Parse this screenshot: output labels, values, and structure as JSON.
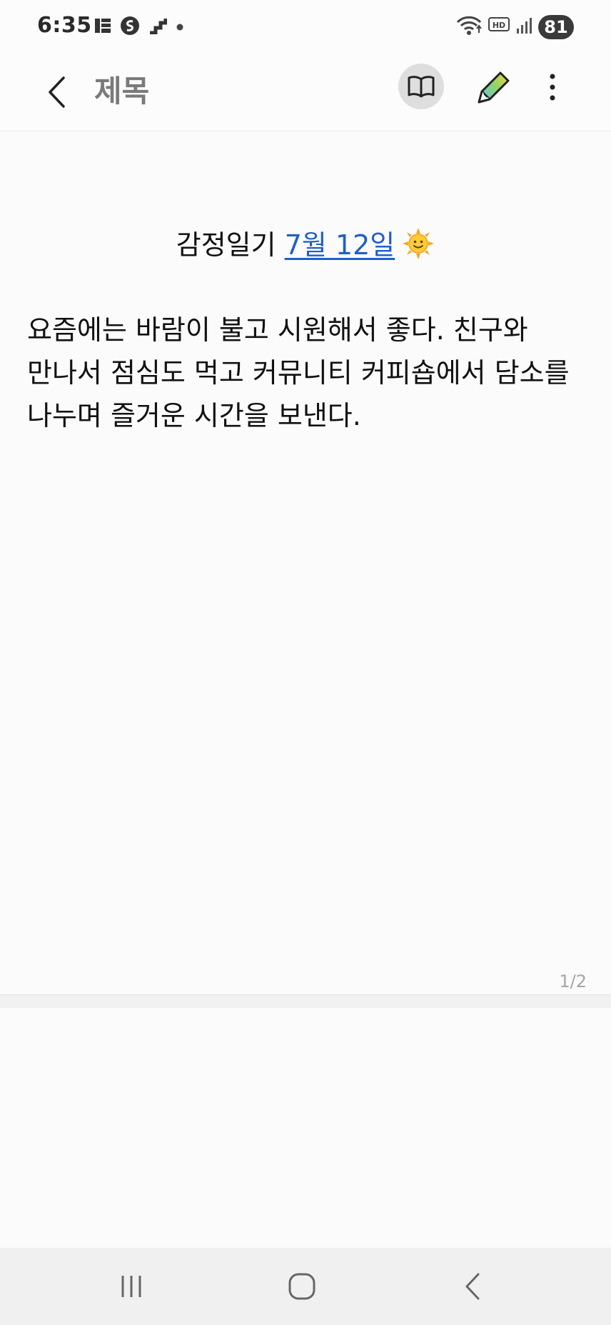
{
  "status_bar": {
    "time": "6:35",
    "battery": "81",
    "icons": [
      "grid-notification-icon",
      "samsung-s-icon",
      "staircase-icon",
      "dot-icon",
      "wifi-icon",
      "hd-voice-icon",
      "signal-icon"
    ]
  },
  "app_bar": {
    "title": "제목",
    "icons": [
      "back-chevron-icon",
      "book-reader-icon",
      "pen-icon",
      "more-vertical-icon"
    ]
  },
  "note": {
    "title_prefix": "감정일기 ",
    "title_date": "7월 12일",
    "title_emoji": "sun-face-icon",
    "body": "요즘에는 바람이 불고 시원해서 좋다.  친구와 만나서 점심도 먹고 커뮤니티 커피숍에서 담소를 나누며 즐거운 시간을 보낸다."
  },
  "page_indicator": "1/2",
  "colors": {
    "link": "#1f5fc9",
    "title_gray": "#7a7a7a",
    "background": "#fbfbfb",
    "nav_background": "#f0f0f0"
  },
  "nav_bar": {
    "icons": [
      "recent-apps-icon",
      "home-icon",
      "back-icon"
    ]
  }
}
